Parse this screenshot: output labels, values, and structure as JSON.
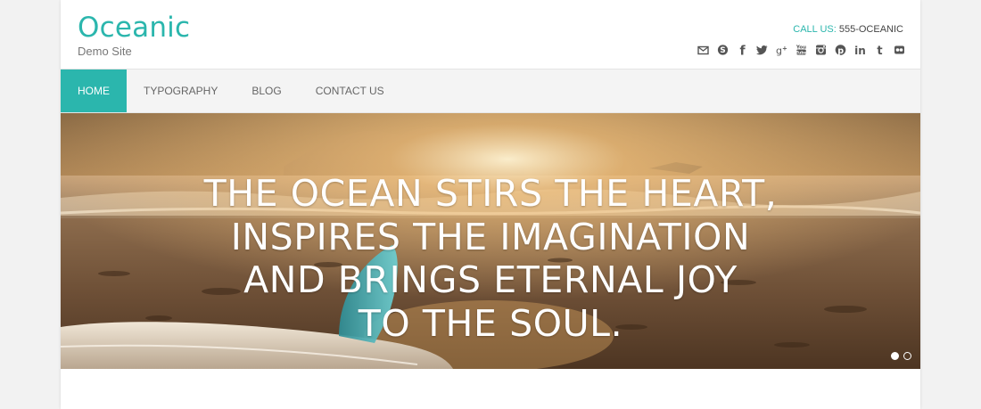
{
  "site": {
    "title": "Oceanic",
    "tagline": "Demo Site"
  },
  "contact": {
    "label": "CALL US:",
    "phone": "555-OCEANIC"
  },
  "social_icons": [
    "email-icon",
    "skype-icon",
    "facebook-icon",
    "twitter-icon",
    "google-plus-icon",
    "youtube-icon",
    "instagram-icon",
    "pinterest-icon",
    "linkedin-icon",
    "tumblr-icon",
    "flickr-icon"
  ],
  "nav": {
    "items": [
      {
        "label": "HOME",
        "active": true
      },
      {
        "label": "TYPOGRAPHY",
        "active": false
      },
      {
        "label": "BLOG",
        "active": false
      },
      {
        "label": "CONTACT US",
        "active": false
      }
    ]
  },
  "hero": {
    "lines": [
      "THE OCEAN STIRS THE HEART,",
      "INSPIRES THE IMAGINATION",
      "AND BRINGS ETERNAL JOY",
      "TO THE SOUL."
    ],
    "slides": [
      {
        "active": true
      },
      {
        "active": false
      }
    ]
  },
  "colors": {
    "accent": "#2bb6ad",
    "nav_bg": "#f4f4f4",
    "icon": "#555555"
  }
}
